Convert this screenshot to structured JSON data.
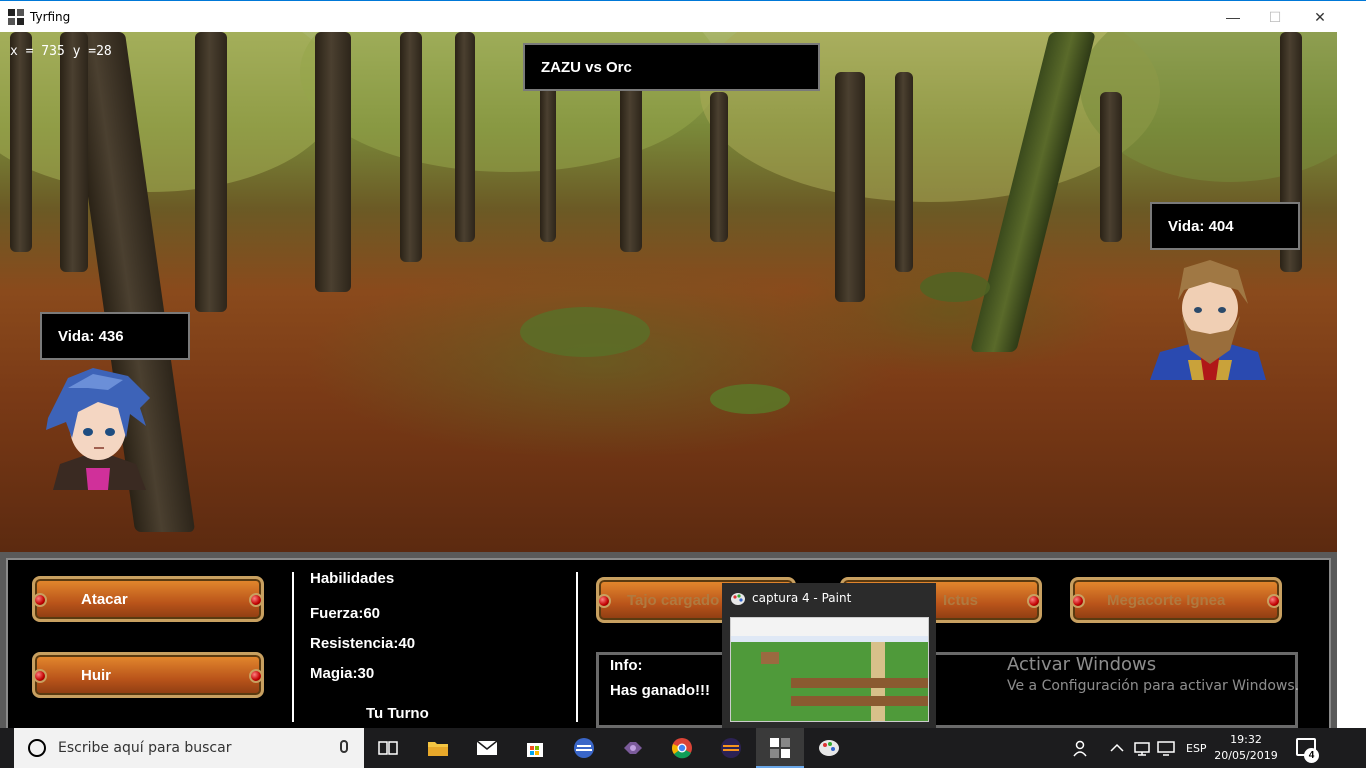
{
  "window": {
    "title": "Tyrfing",
    "minimize": "—",
    "maximize": "☐",
    "close": "✕"
  },
  "scene": {
    "coordinates": "x = 735 y =28",
    "matchup": "ZAZU vs Orc",
    "player_hp": "Vida: 436",
    "enemy_hp": "Vida: 404"
  },
  "panel": {
    "attack_label": "Atacar",
    "flee_label": "Huir",
    "skills_title": "Habilidades",
    "strength": "Fuerza:60",
    "resistance": "Resistencia:40",
    "magic": "Magia:30",
    "turn": "Tu Turno",
    "skill1_label": "Tajo cargado",
    "skill2_label": "Ictus",
    "skill3_label": "Megacorte Ignea",
    "info_label": "Info:",
    "info_message": "Has ganado!!!"
  },
  "paint_preview": {
    "title": "captura 4 - Paint"
  },
  "watermark": {
    "line1": "Activar Windows",
    "line2": "Ve a Configuración para activar Windows."
  },
  "taskbar": {
    "search_placeholder": "Escribe aquí para buscar",
    "language": "ESP",
    "time": "19:32",
    "date": "20/05/2019",
    "notifications": "4"
  },
  "colors": {
    "orange_button": "#c8601e",
    "panel_bg": "#000000",
    "taskbar_bg": "#1c1c1e",
    "accent": "#0078d7"
  }
}
